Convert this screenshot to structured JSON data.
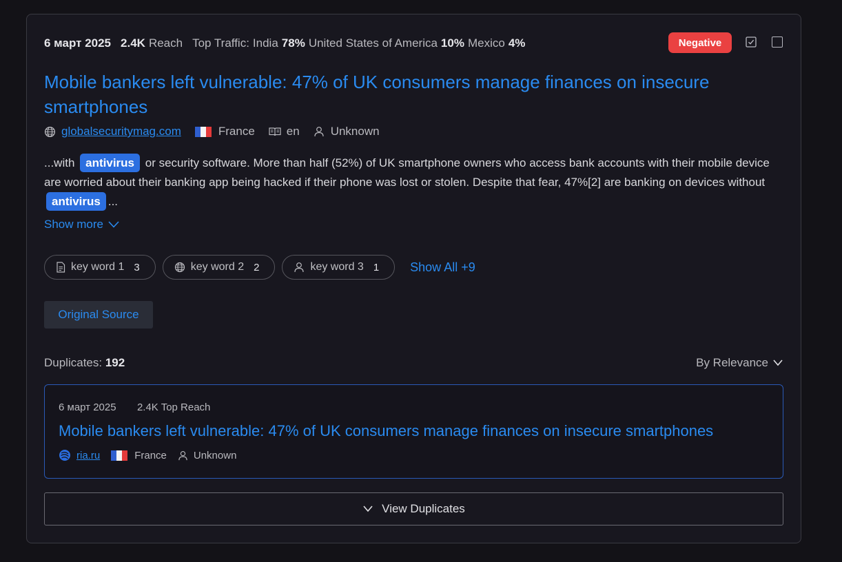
{
  "item": {
    "date": "6 март 2025",
    "reach_value": "2.4K",
    "reach_label": "Reach",
    "top_traffic_label": "Top Traffic:",
    "traffic": [
      {
        "country": "India",
        "percent": "78%"
      },
      {
        "country": "United States of America",
        "percent": "10%"
      },
      {
        "country": "Mexico",
        "percent": "4%"
      }
    ],
    "sentiment": "Negative",
    "sentiment_color": "#ea4141",
    "title": "Mobile bankers left vulnerable: 47% of UK consumers manage finances on insecure smartphones",
    "source": {
      "domain": "globalsecuritymag.com",
      "country": "France",
      "language": "en",
      "author": "Unknown"
    },
    "snippet": {
      "part1": "...with",
      "highlight1": "antivirus",
      "part2": "or security software. More than half (52%) of UK smartphone owners who access bank accounts with their mobile device are worried about their banking app being hacked if their phone was lost or stolen. Despite that fear, 47%[2] are banking on devices without",
      "highlight2": "antivirus",
      "part3": "..."
    },
    "show_more_label": "Show more",
    "keywords": [
      {
        "label": "key word 1",
        "count": "3",
        "icon": "document-icon"
      },
      {
        "label": "key word 2",
        "count": "2",
        "icon": "globe-icon"
      },
      {
        "label": "key word 3",
        "count": "1",
        "icon": "user-icon"
      }
    ],
    "show_all_label": "Show All +9",
    "original_source_label": "Original Source"
  },
  "duplicates": {
    "label": "Duplicates:",
    "count": "192",
    "sort_label": "By Relevance",
    "first": {
      "date": "6 март 2025",
      "reach": "2.4K Top Reach",
      "title": "Mobile bankers left vulnerable: 47% of UK consumers manage finances on insecure smartphones",
      "domain": "ria.ru",
      "country": "France",
      "author": "Unknown"
    },
    "view_label": "View Duplicates"
  },
  "colors": {
    "accent": "#2a8bf0",
    "highlight": "#2c6fe0",
    "background": "#131217",
    "card": "#18171f"
  }
}
